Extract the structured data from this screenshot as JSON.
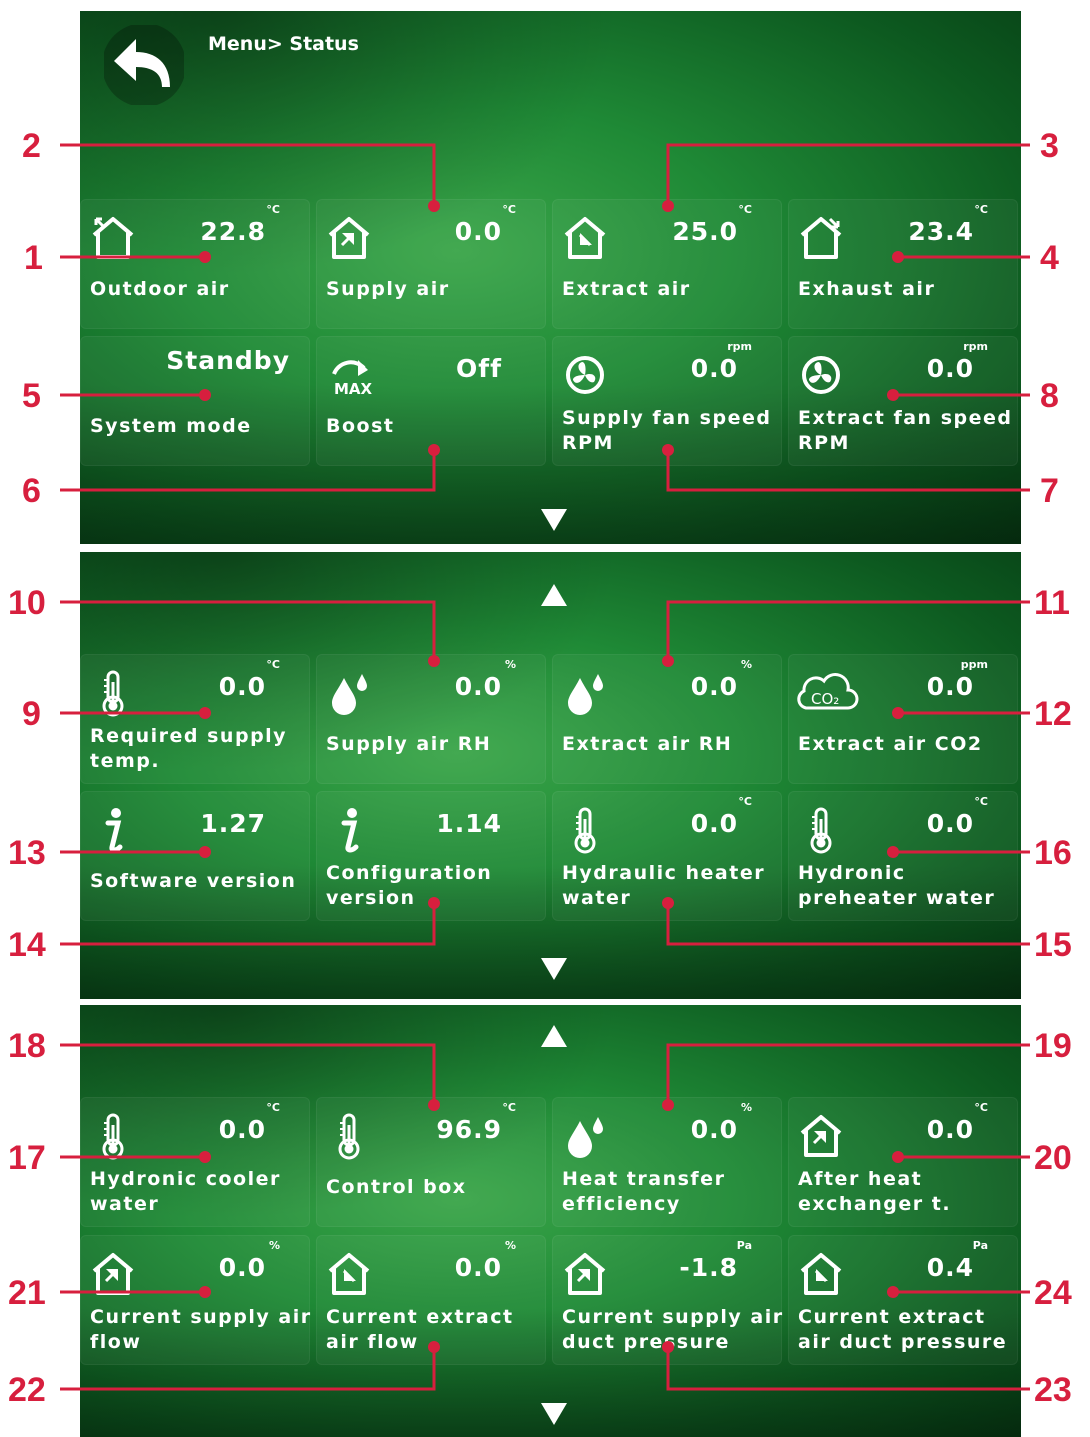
{
  "header": {
    "breadcrumb": "Menu> Status"
  },
  "colors": {
    "accent": "#d71f3e",
    "background": "#1f8a36"
  },
  "screens": [
    {
      "tiles": [
        {
          "icon": "outdoor-air-icon",
          "label": "Outdoor air",
          "value": "22.8",
          "unit": "°C"
        },
        {
          "icon": "supply-air-icon",
          "label": "Supply air",
          "value": "0.0",
          "unit": "°C"
        },
        {
          "icon": "extract-air-icon",
          "label": "Extract air",
          "value": "25.0",
          "unit": "°C"
        },
        {
          "icon": "exhaust-air-icon",
          "label": "Exhaust air",
          "value": "23.4",
          "unit": "°C"
        },
        {
          "icon": "none",
          "label": "System mode",
          "value": "Standby",
          "unit": ""
        },
        {
          "icon": "boost-max-icon",
          "label": "Boost",
          "value": "Off",
          "unit": ""
        },
        {
          "icon": "fan-icon",
          "label": "Supply fan speed RPM",
          "value": "0.0",
          "unit": "rpm"
        },
        {
          "icon": "fan-icon",
          "label": "Extract fan speed RPM",
          "value": "0.0",
          "unit": "rpm"
        }
      ]
    },
    {
      "tiles": [
        {
          "icon": "thermometer-icon",
          "label": "Required supply temp.",
          "value": "0.0",
          "unit": "°C"
        },
        {
          "icon": "humidity-drops-icon",
          "label": "Supply air RH",
          "value": "0.0",
          "unit": "%"
        },
        {
          "icon": "humidity-drops-icon",
          "label": "Extract air RH",
          "value": "0.0",
          "unit": "%"
        },
        {
          "icon": "co2-cloud-icon",
          "label": "Extract air CO2",
          "value": "0.0",
          "unit": "ppm"
        },
        {
          "icon": "info-icon",
          "label": "Software version",
          "value": "1.27",
          "unit": ""
        },
        {
          "icon": "info-icon",
          "label": "Configuration version",
          "value": "1.14",
          "unit": ""
        },
        {
          "icon": "thermometer-icon",
          "label": "Hydraulic heater water",
          "value": "0.0",
          "unit": "°C"
        },
        {
          "icon": "thermometer-icon",
          "label": "Hydronic preheater water",
          "value": "0.0",
          "unit": "°C"
        }
      ]
    },
    {
      "tiles": [
        {
          "icon": "thermometer-icon",
          "label": "Hydronic cooler water",
          "value": "0.0",
          "unit": "°C"
        },
        {
          "icon": "thermometer-icon",
          "label": "Control box",
          "value": "96.9",
          "unit": "°C"
        },
        {
          "icon": "humidity-drops-icon",
          "label": "Heat transfer efficiency",
          "value": "0.0",
          "unit": "%"
        },
        {
          "icon": "house-arrow-icon",
          "label": "After heat exchanger t.",
          "value": "0.0",
          "unit": "°C"
        },
        {
          "icon": "house-arrow-icon",
          "label": "Current supply air flow",
          "value": "0.0",
          "unit": "%"
        },
        {
          "icon": "house-arrow-icon",
          "label": "Current extract air flow",
          "value": "0.0",
          "unit": "%"
        },
        {
          "icon": "house-arrow-icon",
          "label": "Current supply air duct pressure",
          "value": "-1.8",
          "unit": "Pa"
        },
        {
          "icon": "house-arrow-icon",
          "label": "Current extract air duct pressure",
          "value": "0.4",
          "unit": "Pa"
        }
      ]
    }
  ],
  "annotations": [
    "1",
    "2",
    "3",
    "4",
    "5",
    "6",
    "7",
    "8",
    "9",
    "10",
    "11",
    "12",
    "13",
    "14",
    "15",
    "16",
    "17",
    "18",
    "19",
    "20",
    "21",
    "22",
    "23",
    "24"
  ]
}
